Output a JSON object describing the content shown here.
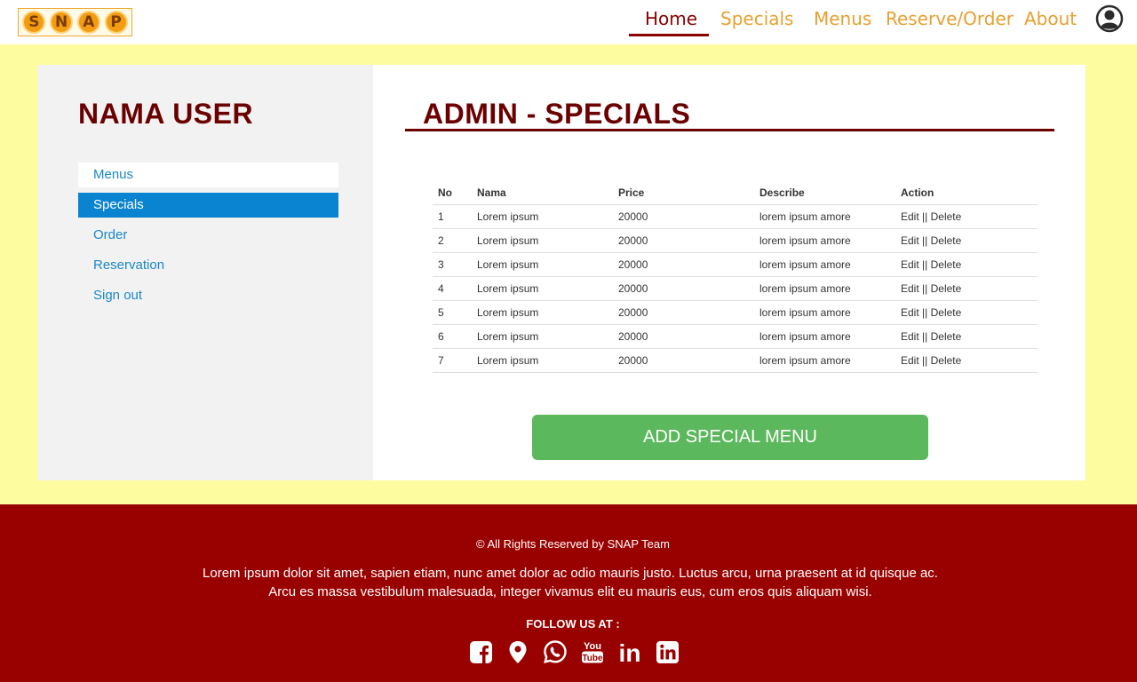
{
  "header": {
    "logo_letters": [
      "S",
      "N",
      "A",
      "P"
    ],
    "nav": [
      {
        "label": "Home",
        "active": true
      },
      {
        "label": "Specials"
      },
      {
        "label": "Menus"
      },
      {
        "label": "Reserve/Order"
      },
      {
        "label": "About"
      }
    ],
    "avatar_icon": "user-circle-icon"
  },
  "sidebar": {
    "user_name": "NAMA USER",
    "items": [
      {
        "label": "Menus"
      },
      {
        "label": "Specials",
        "active": true
      },
      {
        "label": "Order"
      },
      {
        "label": "Reservation"
      },
      {
        "label": "Sign out"
      }
    ]
  },
  "main": {
    "title": "ADMIN - SPECIALS",
    "table": {
      "columns": [
        "No",
        "Nama",
        "Price",
        "Describe",
        "Action"
      ],
      "rows": [
        {
          "no": "1",
          "nama": "Lorem ipsum",
          "price": "20000",
          "describe": "lorem ipsum amore",
          "edit": "Edit",
          "sep": "||",
          "delete": "Delete"
        },
        {
          "no": "2",
          "nama": "Lorem ipsum",
          "price": "20000",
          "describe": "lorem ipsum amore",
          "edit": "Edit",
          "sep": "||",
          "delete": "Delete"
        },
        {
          "no": "3",
          "nama": "Lorem ipsum",
          "price": "20000",
          "describe": "lorem ipsum amore",
          "edit": "Edit",
          "sep": "||",
          "delete": "Delete"
        },
        {
          "no": "4",
          "nama": "Lorem ipsum",
          "price": "20000",
          "describe": "lorem ipsum amore",
          "edit": "Edit",
          "sep": "||",
          "delete": "Delete"
        },
        {
          "no": "5",
          "nama": "Lorem ipsum",
          "price": "20000",
          "describe": "lorem ipsum amore",
          "edit": "Edit",
          "sep": "||",
          "delete": "Delete"
        },
        {
          "no": "6",
          "nama": "Lorem ipsum",
          "price": "20000",
          "describe": "lorem ipsum amore",
          "edit": "Edit",
          "sep": "||",
          "delete": "Delete"
        },
        {
          "no": "7",
          "nama": "Lorem ipsum",
          "price": "20000",
          "describe": "lorem ipsum amore",
          "edit": "Edit",
          "sep": "||",
          "delete": "Delete"
        }
      ]
    },
    "add_button": "ADD SPECIAL MENU"
  },
  "footer": {
    "copyright": "© All Rights Reserved by SNAP Team",
    "text_line1": "Lorem ipsum dolor sit amet, sapien etiam, nunc amet dolor ac odio mauris justo. Luctus arcu, urna praesent at id quisque ac.",
    "text_line2": "Arcu es massa vestibulum malesuada, integer vivamus elit eu mauris eus, cum eros quis aliquam wisi.",
    "follow": "FOLLOW US AT :",
    "socials": [
      "facebook-icon",
      "map-pin-icon",
      "whatsapp-icon",
      "youtube-icon",
      "linkedin-icon",
      "linkedin-square-icon"
    ],
    "youtube_text": [
      "You",
      "Tube"
    ],
    "linkedin_text": "in"
  },
  "colors": {
    "accent_dark_red": "#6b0000",
    "nav_orange": "#e6a030",
    "page_yellow": "#fdfd9f",
    "sidebar_active": "#0a84d0",
    "button_green": "#5cb85c",
    "footer_red": "#990000"
  }
}
